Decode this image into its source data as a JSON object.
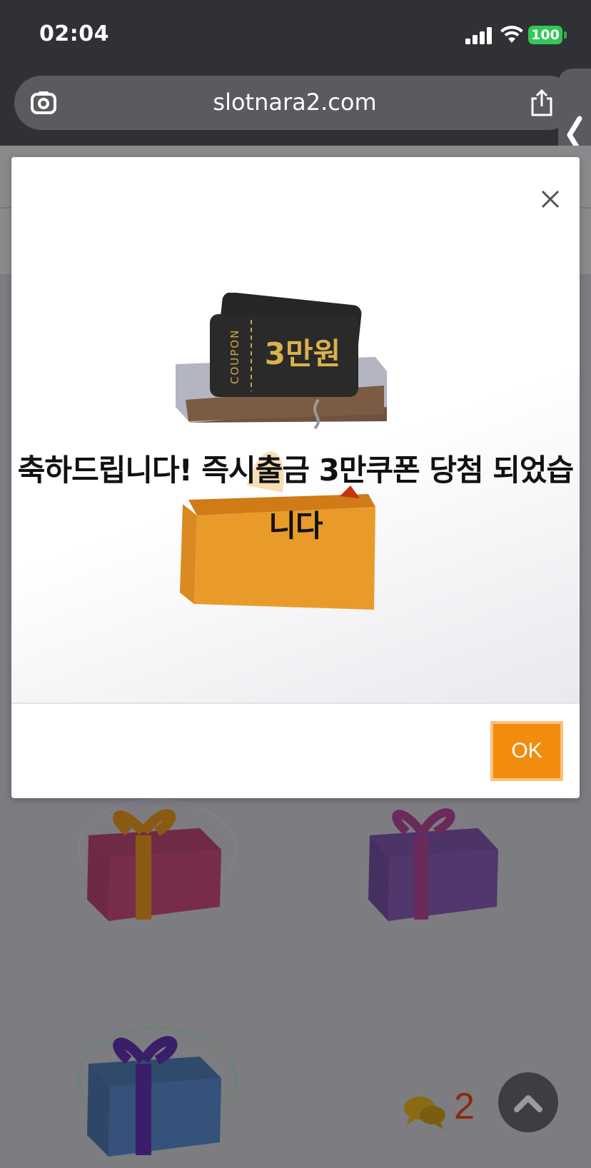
{
  "status_bar": {
    "time": "02:04",
    "battery": "100",
    "battery_color": "#34c759"
  },
  "browser": {
    "url": "slotnara2.com",
    "icons": [
      "lens-icon",
      "share-icon",
      "chevron-left-icon"
    ]
  },
  "modal": {
    "message": "축하드립니다! 즉시출금 3만쿠폰 당첨 되었습니다",
    "coupon_label": "COUPON",
    "coupon_amount": "3만원",
    "ok_label": "OK",
    "accent_color": "#f28c0e"
  },
  "page": {
    "chat_count": "2",
    "gifts": [
      "red-gift-icon",
      "purple-gift-icon",
      "blue-gift-icon"
    ]
  }
}
